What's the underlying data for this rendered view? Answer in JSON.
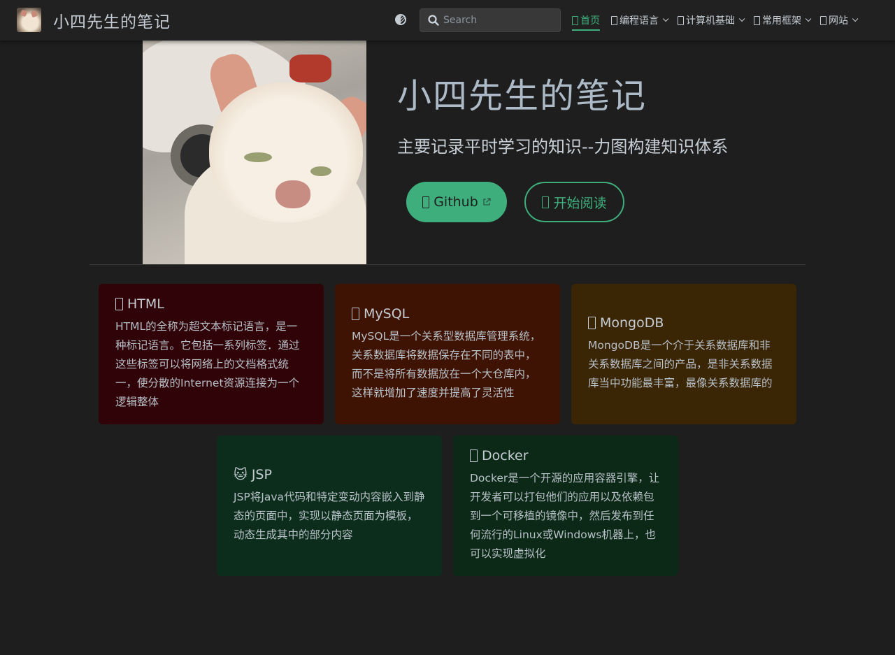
{
  "navbar": {
    "site_name": "小四先生的笔记",
    "search_placeholder": "Search",
    "items": [
      {
        "label": "首页",
        "active": true,
        "dropdown": false
      },
      {
        "label": "编程语言",
        "active": false,
        "dropdown": true
      },
      {
        "label": "计算机基础",
        "active": false,
        "dropdown": true
      },
      {
        "label": "常用框架",
        "active": false,
        "dropdown": true
      },
      {
        "label": "网站",
        "active": false,
        "dropdown": true
      }
    ]
  },
  "hero": {
    "title": "小四先生的笔记",
    "description": "主要记录平时学习的知识--力图构建知识体系",
    "primary_button": "Github",
    "secondary_button": "开始阅读"
  },
  "cards": [
    {
      "title": "HTML",
      "text": "HTML的全称为超文本标记语言，是一种标记语言。它包括一系列标签．通过这些标签可以将网络上的文档格式统一，使分散的Internet资源连接为一个逻辑整体",
      "color": "#300308"
    },
    {
      "title": "MySQL",
      "text": "MySQL是一个关系型数据库管理系统，关系数据库将数据保存在不同的表中，而不是将所有数据放在一个大仓库内，这样就增加了速度并提高了灵活性",
      "color": "#3e1303"
    },
    {
      "title": "MongoDB",
      "text": "MongoDB是一个介于关系数据库和非关系数据库之间的产品，是非关系数据库当中功能最丰富，最像关系数据库的",
      "color": "#3a2504"
    },
    {
      "title": "JSP",
      "emoji": "🐱",
      "text": "JSP将Java代码和特定变动内容嵌入到静态的页面中，实现以静态页面为模板，动态生成其中的部分内容",
      "color": "#0c2d1c"
    },
    {
      "title": "Docker",
      "text": "Docker是一个开源的应用容器引擎，让开发者可以打包他们的应用以及依赖包到一个可移植的镜像中，然后发布到任何流行的Linux或Windows机器上，也可以实现虚拟化",
      "color": "#0b2916"
    }
  ],
  "colors": {
    "accent": "#3eaf7c",
    "background": "#1e1e1e",
    "navbar": "#212121"
  }
}
